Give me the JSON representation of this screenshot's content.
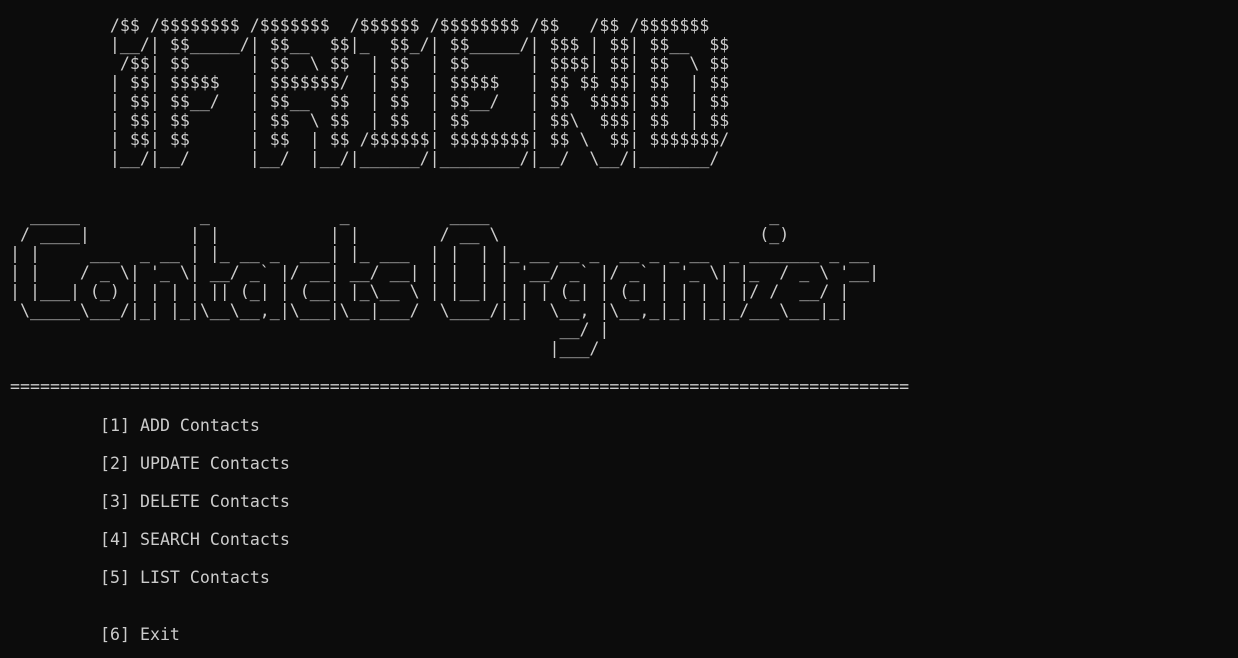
{
  "banner": {
    "findu_art": "          /$$ /$$$$$$$$ /$$$$$$$  /$$$$$$ /$$$$$$$$ /$$   /$$ /$$$$$$$\n          |__/| $$_____/| $$__  $$|_  $$_/| $$_____/| $$$ | $$| $$__  $$\n           /$$| $$      | $$  \\ $$  | $$  | $$      | $$$$| $$| $$  \\ $$\n          | $$| $$$$$   | $$$$$$$/  | $$  | $$$$$   | $$ $$ $$| $$  | $$\n          | $$| $$__/   | $$__  $$  | $$  | $$__/   | $$  $$$$| $$  | $$\n          | $$| $$      | $$  \\ $$  | $$  | $$      | $$\\  $$$| $$  | $$\n          | $$| $$      | $$  | $$ /$$$$$$| $$$$$$$$| $$ \\  $$| $$$$$$$/\n          |__/|__/      |__/  |__/|______/|________/|__/  \\__/|_______/",
    "contacts_art": "  _____            _             _          ____                            _\n / ____|          | |           | |        / __ \\                          (_)\n| |     ___  _ __ | |_ __ _  ___| |_ ___  | |  | |_ __ __ _  __ _ _ __  _ _______ _ __\n| |    / _ \\| '_ \\| __/ _` |/ __| __/ __| | |  | | '__/ _` |/ _` | '_ \\| |_  / _ \\ '__|\n| |___| (_) | | | | || (_| | (__| |_\\__ \\ | |__| | | | (_| | (_| | | | | |/ /  __/ |\n \\_____\\___/|_| |_|\\__\\__,_|\\___|\\__|___/  \\____/|_|  \\__, |\\__,_|_| |_|_/___\\___|_|\n                                                       __/ |\n                                                      |___/"
  },
  "separator": "==========================================================================================",
  "menu": {
    "items": [
      {
        "label": "[1] ADD Contacts"
      },
      {
        "label": "[2] UPDATE Contacts"
      },
      {
        "label": "[3] DELETE Contacts"
      },
      {
        "label": "[4] SEARCH Contacts"
      },
      {
        "label": "[5] LIST Contacts"
      },
      {
        "label": "[6] Exit"
      }
    ]
  },
  "colors": {
    "background": "#0c0c0c",
    "text": "#cccccc"
  }
}
